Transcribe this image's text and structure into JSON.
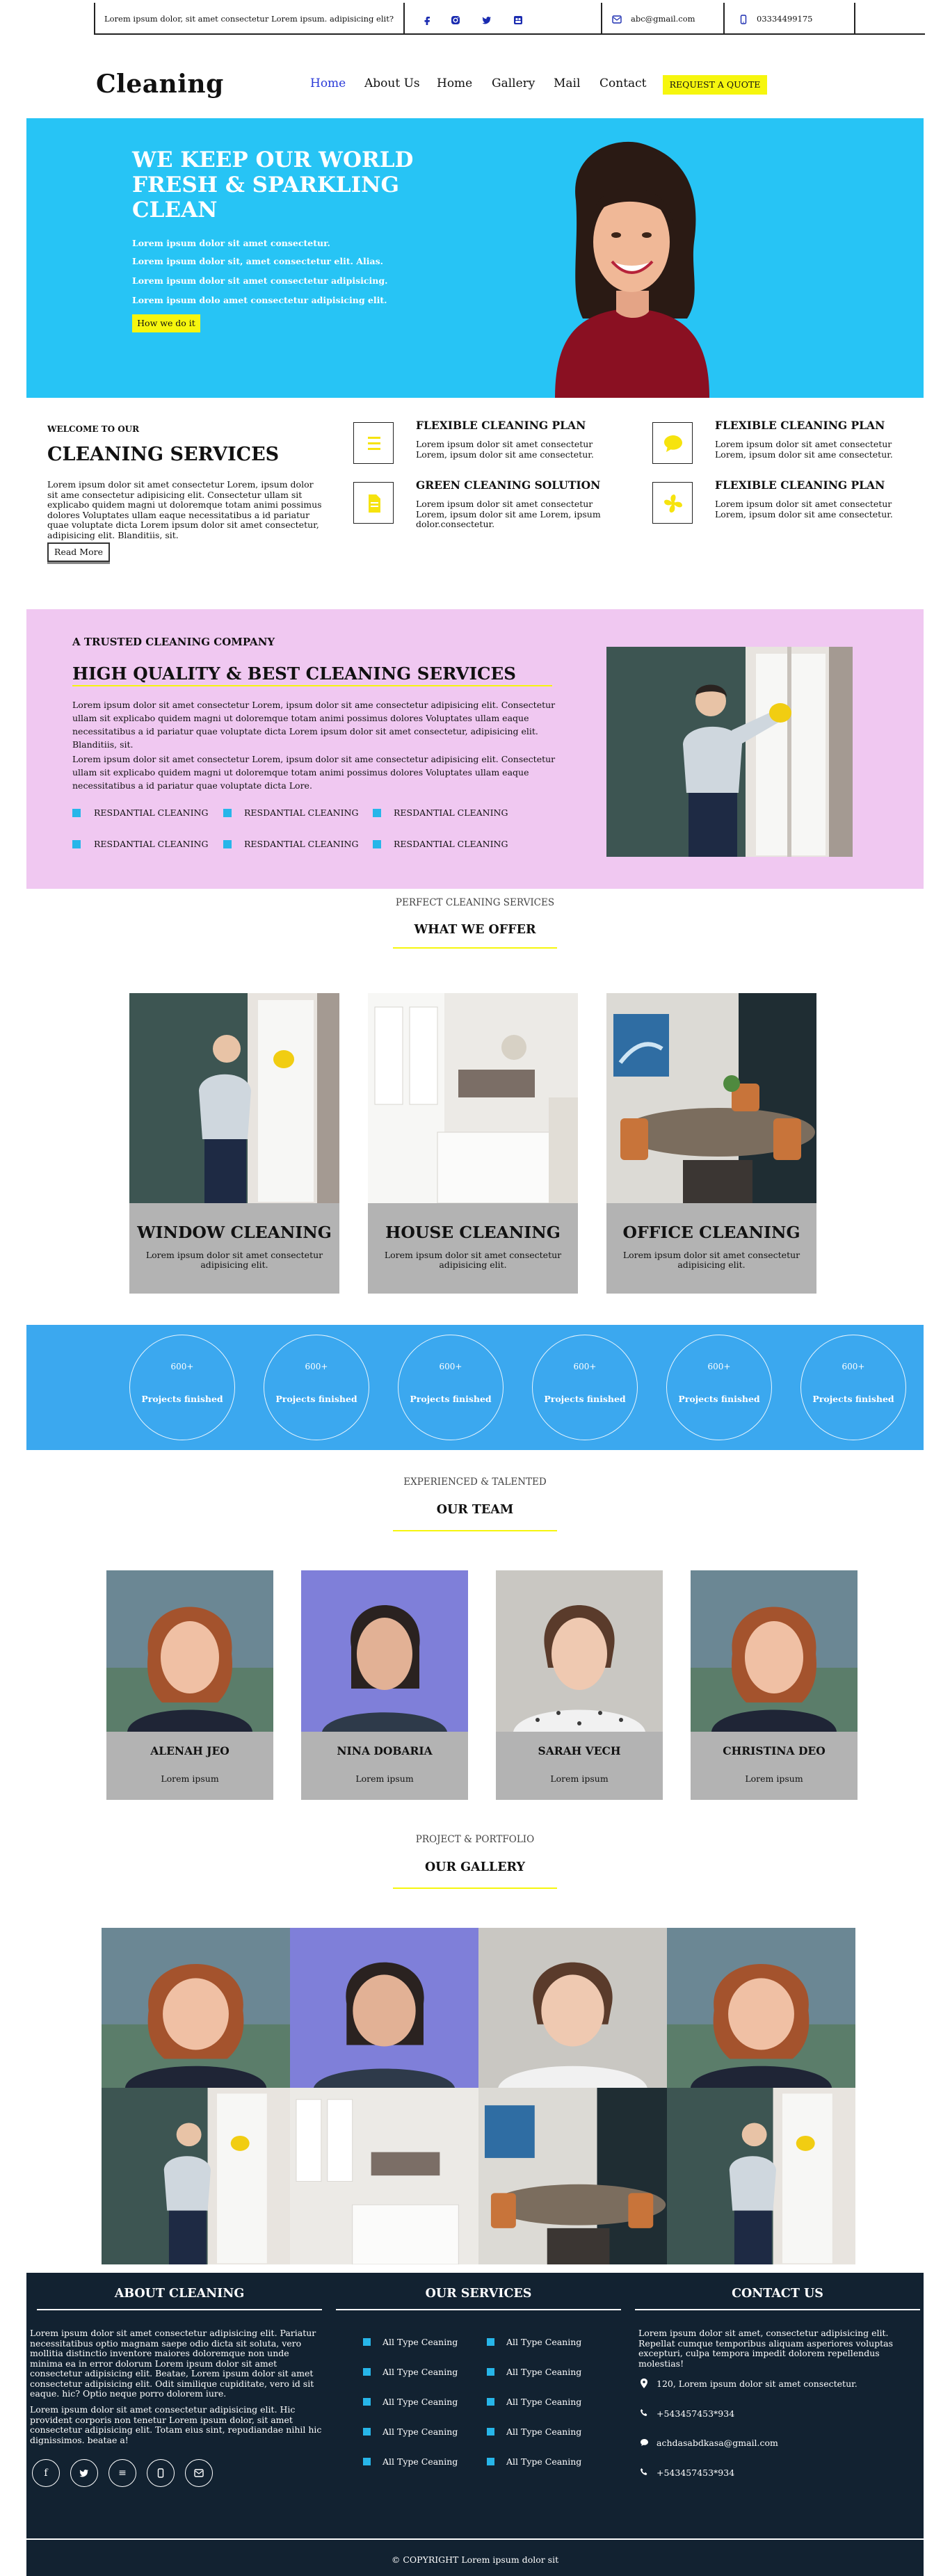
{
  "topbar": {
    "tagline": "Lorem ipsum dolor, sit amet consectetur Lorem ipsum. adipisicing elit?",
    "email": "abc@gmail.com",
    "phone": "03334499175",
    "social_icons": [
      "facebook-icon",
      "instagram-icon",
      "twitter-icon",
      "group-icon"
    ]
  },
  "nav": {
    "logo": "Cleaning",
    "items": [
      "Home",
      "About Us",
      "Home",
      "Gallery",
      "Mail",
      "Contact"
    ],
    "quote_button": "REQUEST A QUOTE"
  },
  "hero": {
    "title": "WE KEEP OUR WORLD FRESH & SPARKLING CLEAN",
    "lines": [
      "Lorem ipsum dolor sit amet consectetur.",
      "Lorem ipsum dolor sit, amet consectetur elit. Alias.",
      "Lorem ipsum dolor sit amet consectetur adipisicing.",
      "Lorem ipsum dolo amet consectetur adipisicing elit."
    ],
    "button": "How we do it"
  },
  "welcome": {
    "small": "WELCOME TO OUR",
    "title": "CLEANING SERVICES",
    "text": "Lorem ipsum dolor sit amet consectetur Lorem, ipsum dolor sit ame consectetur adipisicing elit. Consectetur ullam sit explicabo quidem magni ut doloremque totam animi possimus dolores Voluptates ullam eaque necessitatibus a id pariatur quae voluptate dicta Lorem ipsum dolor sit amet consectetur, adipisicing elit. Blanditiis, sit.",
    "read_more": "Read More",
    "features": [
      {
        "title": "FLEXIBLE CLEANING PLAN",
        "text": "Lorem ipsum dolor sit amet consectetur Lorem, ipsum dolor sit ame consectetur."
      },
      {
        "title": "FLEXIBLE CLEANING PLAN",
        "text": "Lorem ipsum dolor sit amet consectetur Lorem, ipsum dolor sit ame consectetur."
      },
      {
        "title": "GREEN CLEANING SOLUTION",
        "text": "Lorem ipsum dolor sit amet consectetur Lorem, ipsum dolor sit ame Lorem, ipsum dolor.consectetur."
      },
      {
        "title": "FLEXIBLE CLEANING PLAN",
        "text": "Lorem ipsum dolor sit amet consectetur Lorem, ipsum dolor sit ame consectetur."
      }
    ]
  },
  "trusted": {
    "small": "A TRUSTED CLEANING COMPANY",
    "title": "HIGH QUALITY & BEST CLEANING SERVICES",
    "p1": "Lorem ipsum dolor sit amet consectetur Lorem, ipsum dolor sit ame consectetur adipisicing elit. Consectetur ullam sit explicabo quidem magni ut doloremque totam animi possimus dolores Voluptates ullam eaque necessitatibus a id pariatur quae voluptate dicta Lorem ipsum dolor sit amet consectetur, adipisicing elit. Blanditiis, sit.",
    "p2": "Lorem ipsum dolor sit amet consectetur Lorem, ipsum dolor sit ame consectetur adipisicing elit. Consectetur ullam sit explicabo quidem magni ut doloremque totam animi possimus dolores Voluptates ullam eaque necessitatibus a id pariatur quae voluptate dicta Lore.",
    "items": [
      "RESDANTIAL CLEANING",
      "RESDANTIAL CLEANING",
      "RESDANTIAL CLEANING",
      "RESDANTIAL CLEANING",
      "RESDANTIAL CLEANING",
      "RESDANTIAL CLEANING"
    ]
  },
  "offer": {
    "small": "PERFECT CLEANING SERVICES",
    "title": "WHAT WE OFFER",
    "cards": [
      {
        "title": "WINDOW CLEANING",
        "text": "Lorem ipsum dolor sit amet consectetur adipisicing elit."
      },
      {
        "title": "HOUSE CLEANING",
        "text": "Lorem ipsum dolor sit amet consectetur adipisicing elit."
      },
      {
        "title": "OFFICE CLEANING",
        "text": "Lorem ipsum dolor sit amet consectetur adipisicing elit."
      }
    ]
  },
  "stats": [
    {
      "number": "600+",
      "label": "Projects finished"
    },
    {
      "number": "600+",
      "label": "Projects finished"
    },
    {
      "number": "600+",
      "label": "Projects finished"
    },
    {
      "number": "600+",
      "label": "Projects finished"
    },
    {
      "number": "600+",
      "label": "Projects finished"
    },
    {
      "number": "600+",
      "label": "Projects finished"
    }
  ],
  "team": {
    "small": "EXPERIENCED & TALENTED",
    "title": "OUR TEAM",
    "members": [
      {
        "name": "ALENAH JEO",
        "role": "Lorem ipsum"
      },
      {
        "name": "NINA DOBARIA",
        "role": "Lorem ipsum"
      },
      {
        "name": "SARAH VECH",
        "role": "Lorem ipsum"
      },
      {
        "name": "CHRISTINA DEO",
        "role": "Lorem ipsum"
      }
    ]
  },
  "gallery": {
    "small": "PROJECT & PORTFOLIO",
    "title": "OUR GALLERY"
  },
  "footer": {
    "about_title": "ABOUT CLEANING",
    "about_p1": "Lorem ipsum dolor sit amet consectetur adipisicing elit. Pariatur necessitatibus optio magnam saepe odio dicta sit soluta, vero mollitia distinctio inventore maiores doloremque non unde minima ea in error dolorum Lorem ipsum dolor sit amet consectetur adipisicing elit. Beatae, Lorem ipsum dolor sit amet consectetur adipisicing elit. Odit similique cupiditate, vero id sit eaque. hic? Optio neque porro dolorem iure.",
    "about_p2": "Lorem ipsum dolor sit amet consectetur adipisicing elit. Hic provident corporis non tenetur Lorem ipsum dolor, sit amet consectetur adipisicing elit. Totam eius sint, repudiandae nihil hic dignissimos. beatae a!",
    "services_title": "OUR SERVICES",
    "services": [
      "All Type Ceaning",
      "All Type Ceaning",
      "All Type Ceaning",
      "All Type Ceaning",
      "All Type Ceaning",
      "All Type Ceaning",
      "All Type Ceaning",
      "All Type Ceaning",
      "All Type Ceaning",
      "All Type Ceaning"
    ],
    "contact_title": "CONTACT US",
    "contact_text": "Lorem ipsum dolor sit amet, consectetur adipisicing elit. Repellat cumque temporibus aliquam asperiores voluptas excepturi, culpa tempora impedit dolorem repellendus molestias!",
    "address": "120, Lorem ipsum dolor sit amet consectetur.",
    "phone1": "+543457453*934",
    "email": "achdasabdkasa@gmail.com",
    "phone2": "+543457453*934",
    "copyright": "© COPYRIGHT Lorem ipsum dolor sit"
  },
  "colors": {
    "hero_bg": "#27c4f5",
    "accent_yellow": "#f6f60e",
    "trusted_bg": "#f0c8f1",
    "stats_bg": "#3ba8ef",
    "footer_bg": "#122231",
    "card_gray": "#b3b3b3",
    "nav_active": "#2a3ad8"
  }
}
